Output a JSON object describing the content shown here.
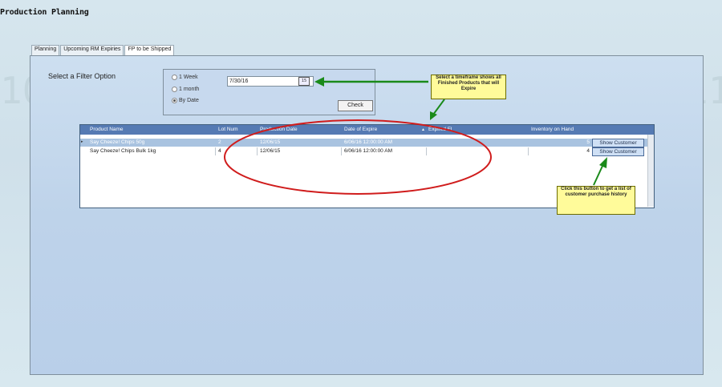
{
  "app": {
    "title": "Production Planning"
  },
  "tabs": [
    "Planning",
    "Upcoming RM Expiries",
    "FP to be Shipped"
  ],
  "filter": {
    "label": "Select a Filter Option",
    "options": [
      "1 Week",
      "1 month",
      "By Date"
    ],
    "selected": "By Date",
    "date_value": "7/30/16",
    "calendar_icon": "15",
    "check_label": "Check"
  },
  "callouts": {
    "timeframe": "Select a timeframe shows all Finished Products that will Expire",
    "button": "Click this button to get a list of customer purchase history"
  },
  "grid": {
    "columns": [
      "Product Name",
      "Lot Num",
      "Production Date",
      "Date of Expire",
      "Expired Fl",
      "Inventory on Hand",
      ""
    ],
    "rows": [
      {
        "product": "Say Cheeze! Chips 50g",
        "lot": "2",
        "production_date": "12/06/15",
        "expire_date": "6/06/16 12:00:00 AM",
        "expired": "",
        "inventory": "5",
        "action": "Show Customer"
      },
      {
        "product": "Say Cheeze! Chips Bulk 1kg",
        "lot": "4",
        "production_date": "12/06/15",
        "expire_date": "6/06/16 12:00:00 AM",
        "expired": "",
        "inventory": "4",
        "action": "Show Customer"
      }
    ]
  },
  "colors": {
    "header_bg": "#557ab3",
    "selected_row": "#a9c3e0",
    "callout_bg": "#fffb9a",
    "arrow": "#1a8a1a",
    "annotation_ellipse": "#d01c1c"
  }
}
